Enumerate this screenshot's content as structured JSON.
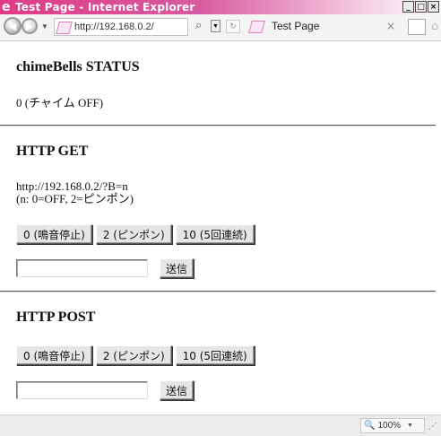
{
  "window": {
    "title": "Test Page - Internet Explorer",
    "logo_glyph": "e",
    "min_glyph": "_",
    "max_glyph": "□",
    "close_glyph": "×"
  },
  "addressbar": {
    "back_glyph": "◀",
    "forward_glyph": "▶",
    "nav_dropdown_glyph": "▼",
    "url": "http://192.168.0.2/",
    "search_glyph": "⌕",
    "dropdown_glyph": "▼",
    "refresh_glyph": "↻",
    "tab_label": "Test Page",
    "tab_close_glyph": "×",
    "home_glyph": "⌂"
  },
  "status": {
    "heading": "chimeBells STATUS",
    "value": "0 (チャイム OFF)"
  },
  "get": {
    "heading": "HTTP GET",
    "example_url": "http://192.168.0.2/?B=n",
    "legend": "(n: 0=OFF, 2=ピンポン)",
    "buttons": [
      "0 (鳴音停止)",
      "2 (ピンポン)",
      "10 (5回連続)"
    ],
    "input_value": "",
    "submit_label": "送信"
  },
  "post": {
    "heading": "HTTP POST",
    "buttons": [
      "0 (鳴音停止)",
      "2 (ピンポン)",
      "10 (5回連続)"
    ],
    "input_value": "",
    "submit_label": "送信"
  },
  "statusbar": {
    "zoom_glyph": "🔍",
    "zoom_text": "100%",
    "zoom_dropdown_glyph": "▼",
    "grip_glyph": "⋰"
  },
  "colors": {
    "titlebar_accent": "#e03a86",
    "page_background": "#ffffff"
  }
}
